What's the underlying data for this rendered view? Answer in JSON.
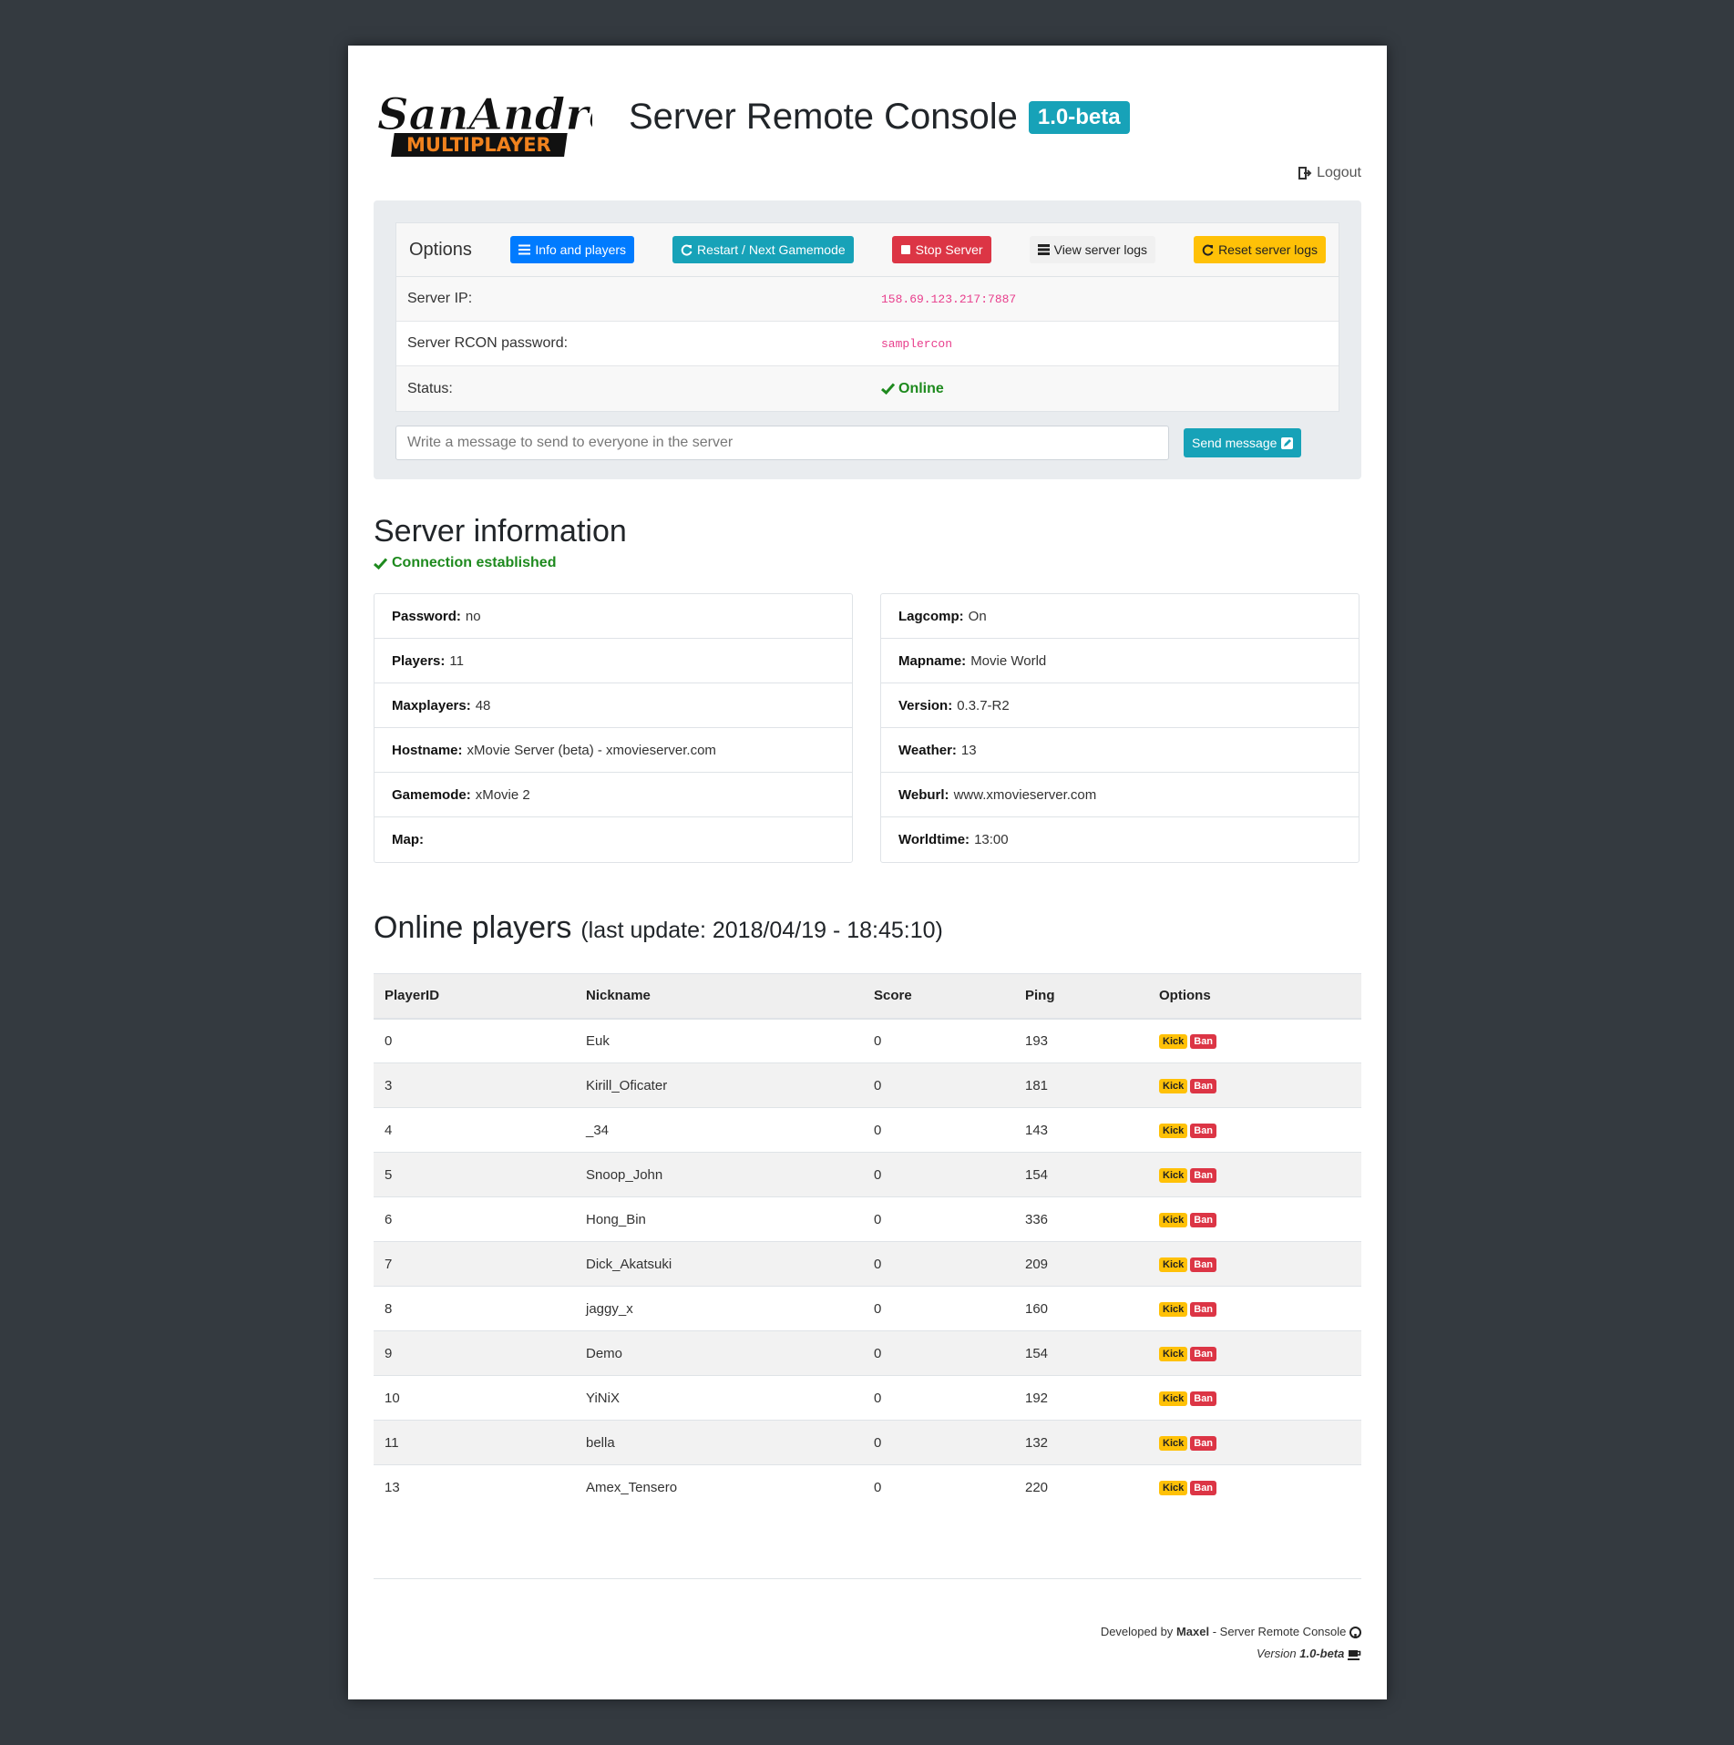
{
  "header": {
    "logo_text_top": "SanAndreas",
    "logo_text_bottom": "MULTIPLAYER",
    "title": "Server Remote Console",
    "version_badge": "1.0-beta",
    "logout_label": "Logout"
  },
  "options": {
    "label": "Options",
    "buttons": {
      "info": "Info and players",
      "restart": "Restart / Next Gamemode",
      "stop": "Stop Server",
      "view_logs": "View server logs",
      "reset_logs": "Reset server logs"
    },
    "rows": {
      "ip_label": "Server IP:",
      "ip_value": "158.69.123.217:7887",
      "rcon_label": "Server RCON password:",
      "rcon_value": "samplercon",
      "status_label": "Status:",
      "status_value": "Online"
    },
    "message_placeholder": "Write a message to send to everyone in the server",
    "send_label": "Send message"
  },
  "server_info": {
    "title": "Server information",
    "connection": "Connection established",
    "left": [
      {
        "key": "Password:",
        "value": "no"
      },
      {
        "key": "Players:",
        "value": "11"
      },
      {
        "key": "Maxplayers:",
        "value": "48"
      },
      {
        "key": "Hostname:",
        "value": "xMovie Server (beta) - xmovieserver.com"
      },
      {
        "key": "Gamemode:",
        "value": "xMovie 2"
      },
      {
        "key": "Map:",
        "value": ""
      }
    ],
    "right": [
      {
        "key": "Lagcomp:",
        "value": "On"
      },
      {
        "key": "Mapname:",
        "value": "Movie World"
      },
      {
        "key": "Version:",
        "value": "0.3.7-R2"
      },
      {
        "key": "Weather:",
        "value": "13"
      },
      {
        "key": "Weburl:",
        "value": "www.xmovieserver.com"
      },
      {
        "key": "Worldtime:",
        "value": "13:00"
      }
    ]
  },
  "players": {
    "title": "Online players",
    "last_update": "(last update: 2018/04/19 - 18:45:10)",
    "columns": [
      "PlayerID",
      "Nickname",
      "Score",
      "Ping",
      "Options"
    ],
    "kick_label": "Kick",
    "ban_label": "Ban",
    "rows": [
      {
        "id": "0",
        "nick": "Euk",
        "score": "0",
        "ping": "193"
      },
      {
        "id": "3",
        "nick": "Kirill_Oficater",
        "score": "0",
        "ping": "181"
      },
      {
        "id": "4",
        "nick": "_34",
        "score": "0",
        "ping": "143"
      },
      {
        "id": "5",
        "nick": "Snoop_John",
        "score": "0",
        "ping": "154"
      },
      {
        "id": "6",
        "nick": "Hong_Bin",
        "score": "0",
        "ping": "336"
      },
      {
        "id": "7",
        "nick": "Dick_Akatsuki",
        "score": "0",
        "ping": "209"
      },
      {
        "id": "8",
        "nick": "jaggy_x",
        "score": "0",
        "ping": "160"
      },
      {
        "id": "9",
        "nick": "Demo",
        "score": "0",
        "ping": "154"
      },
      {
        "id": "10",
        "nick": "YiNiX",
        "score": "0",
        "ping": "192"
      },
      {
        "id": "11",
        "nick": "bella",
        "score": "0",
        "ping": "132"
      },
      {
        "id": "13",
        "nick": "Amex_Tensero",
        "score": "0",
        "ping": "220"
      }
    ]
  },
  "footer": {
    "developed_by": "Developed by",
    "author": "Maxel",
    "project": "- Server Remote Console",
    "version_label": "Version",
    "version": "1.0-beta"
  },
  "colors": {
    "background": "#343a40",
    "primary": "#007bff",
    "info": "#17a2b8",
    "danger": "#dc3545",
    "warning": "#ffc107",
    "success": "#1e8a1e",
    "code": "#e83e8c"
  }
}
